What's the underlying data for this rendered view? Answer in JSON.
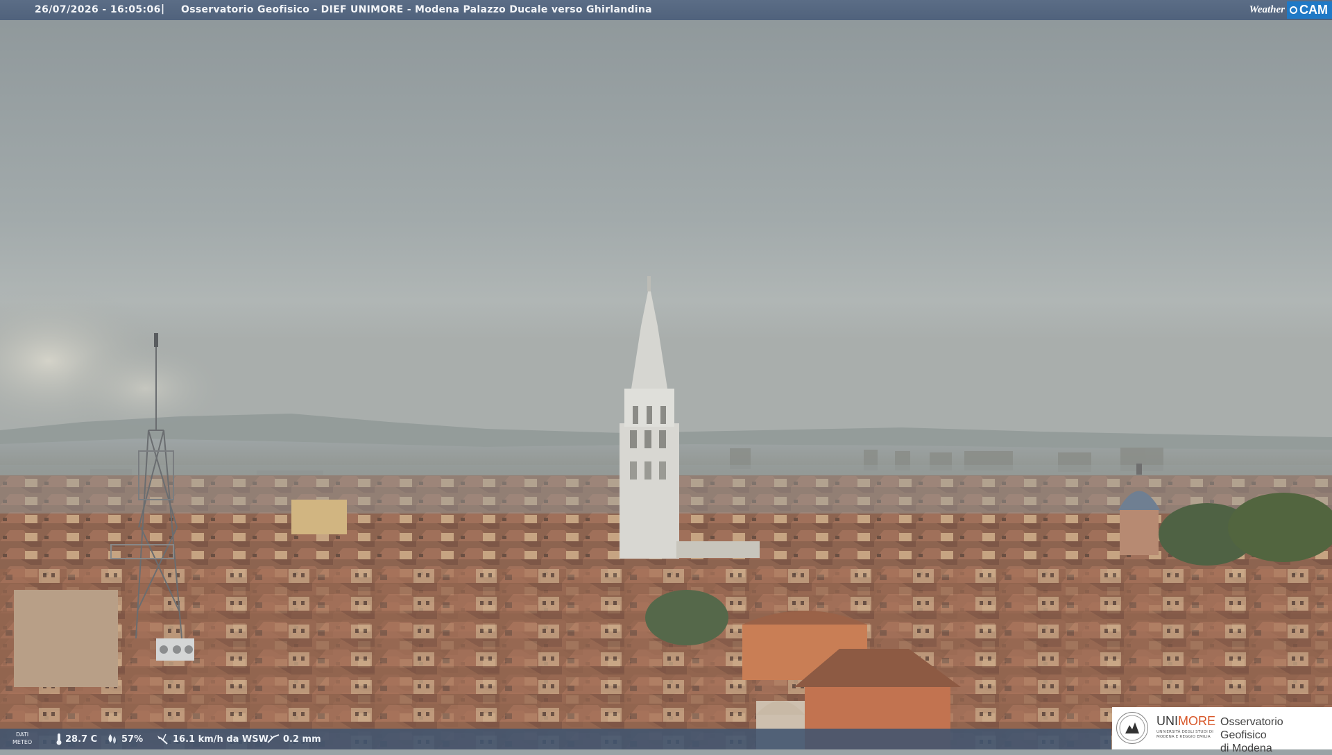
{
  "header": {
    "timestamp": "26/07/2026 - 16:05:06",
    "separator": "|",
    "title": "Osservatorio Geofisico - DIEF UNIMORE - Modena Palazzo Ducale verso Ghirlandina",
    "brand_weather": "Weather",
    "brand_cam": "CAM"
  },
  "meteo": {
    "label_line1": "DATI",
    "label_line2": "METEO",
    "temperature": "28.7 C",
    "humidity": "57%",
    "wind": "16.1 km/h da WSW",
    "rain": "0.2 mm",
    "icons": [
      "thermometer-icon",
      "humidity-drop-icon",
      "wind-vane-icon",
      "rain-gauge-icon"
    ]
  },
  "logo": {
    "uni_prefix": "UNI",
    "uni_suffix": "MORE",
    "uni_sub1": "UNIVERSITÀ DEGLI STUDI DI",
    "uni_sub2": "MODENA E REGGIO EMILIA",
    "observatory_line1": "Osservatorio Geofisico",
    "observatory_line2": "di Modena",
    "accent_color": "#d8582a"
  },
  "colors": {
    "topbar": "#56687f",
    "meteobar": "#405470",
    "brand_blue": "#1f79c6"
  }
}
